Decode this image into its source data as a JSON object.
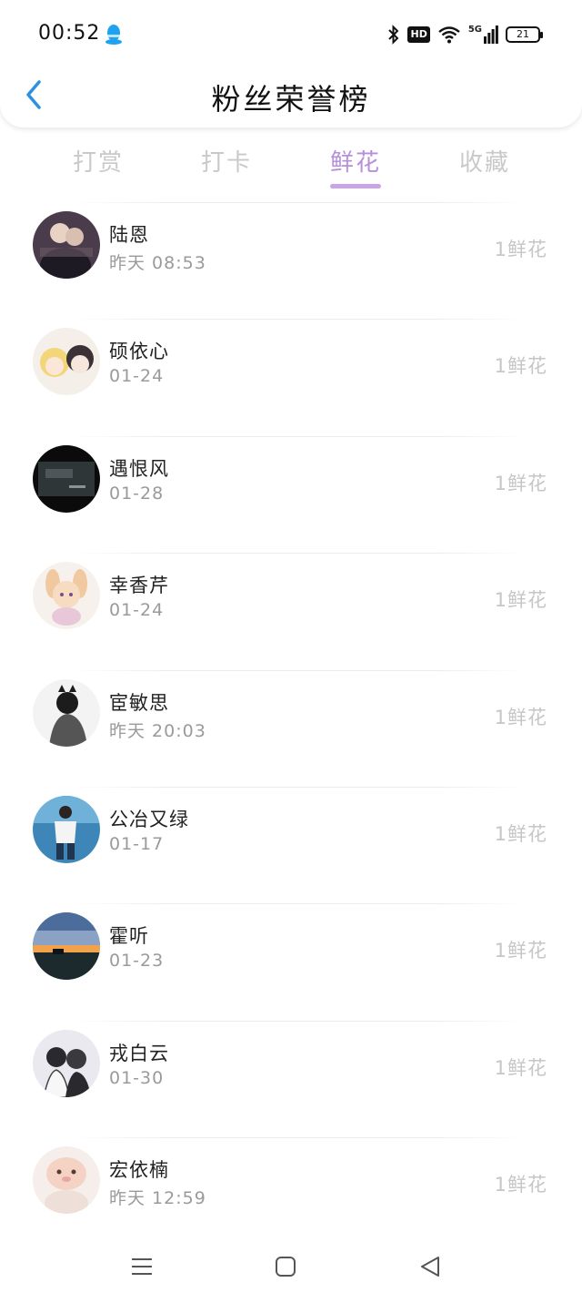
{
  "status_bar": {
    "time": "00:52",
    "network": "5G",
    "hd": "HD",
    "battery": "21"
  },
  "header": {
    "title": "粉丝荣誉榜"
  },
  "tabs": [
    {
      "label": "打赏",
      "active": false
    },
    {
      "label": "打卡",
      "active": false
    },
    {
      "label": "鲜花",
      "active": true
    },
    {
      "label": "收藏",
      "active": false
    }
  ],
  "fans": [
    {
      "name": "陆恩",
      "time": "昨天 08:53",
      "value": "1鲜花",
      "avatar": "avatar-dark-couple"
    },
    {
      "name": "硕依心",
      "time": "01-24",
      "value": "1鲜花",
      "avatar": "avatar-anime-pair"
    },
    {
      "name": "遇恨风",
      "time": "01-28",
      "value": "1鲜花",
      "avatar": "avatar-dark-screen"
    },
    {
      "name": "幸香芹",
      "time": "01-24",
      "value": "1鲜花",
      "avatar": "avatar-bunny-girl"
    },
    {
      "name": "宦敏思",
      "time": "昨天 20:03",
      "value": "1鲜花",
      "avatar": "avatar-cat-girl"
    },
    {
      "name": "公冶又绿",
      "time": "01-17",
      "value": "1鲜花",
      "avatar": "avatar-boy-blue"
    },
    {
      "name": "霍听",
      "time": "01-23",
      "value": "1鲜花",
      "avatar": "avatar-sunset"
    },
    {
      "name": "戎白云",
      "time": "01-30",
      "value": "1鲜花",
      "avatar": "avatar-bw-couple"
    },
    {
      "name": "宏依楠",
      "time": "昨天 12:59",
      "value": "1鲜花",
      "avatar": "avatar-cute-cat"
    }
  ],
  "colors": {
    "accent": "#b58fdb",
    "indicator": "#c9a5e8",
    "back_arrow": "#2f8fe0",
    "qq": "#1fa3f0"
  }
}
